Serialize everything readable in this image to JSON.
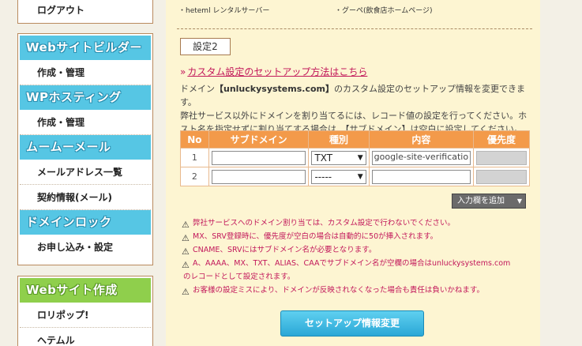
{
  "sidebar": {
    "top_item": "ログアウト",
    "sections": [
      {
        "header": "Webサイトビルダー",
        "items": [
          "作成・管理"
        ]
      },
      {
        "header": "WPホスティング",
        "items": [
          "作成・管理"
        ]
      },
      {
        "header": "ムームーメール",
        "items": [
          "メールアドレス一覧",
          "契約情報(メール)"
        ]
      },
      {
        "header": "ドメインロック",
        "items": [
          "お申し込み・設定"
        ]
      }
    ],
    "bottom_section": {
      "header": "Webサイト作成",
      "items": [
        "ロリポップ!",
        "ヘテムル"
      ]
    }
  },
  "top_links": [
    "・heteml レンタルサーバー",
    "・グーペ(飲食店ホームページ)"
  ],
  "setting_tag": "設定2",
  "help_link": "カスタム設定のセットアップ方法はこちら",
  "description": {
    "p1_pre": "ドメイン",
    "domain": "【unluckysystems.com】",
    "p1_post": "のカスタム設定のセットアップ情報を変更できます。",
    "p2": "弊社サービス以外にドメインを割り当てるには、レコード値の設定を行ってください。ホスト名を指定せずに割り当てする場合は、【サブドメイン】は空白に設定してください。"
  },
  "table": {
    "headers": [
      "No",
      "サブドメイン",
      "種別",
      "内容",
      "優先度"
    ],
    "rows": [
      {
        "no": "1",
        "subdomain": "",
        "type": "TXT",
        "content": "google-site-verificatio",
        "priority": ""
      },
      {
        "no": "2",
        "subdomain": "",
        "type": "-----",
        "content": "",
        "priority": ""
      }
    ]
  },
  "add_row_button": "入力欄を追加",
  "notes": [
    "弊社サービスへのドメイン割り当ては、カスタム設定で行わないでください。",
    "MX、SRV登録時に、優先度が空白の場合は自動的に50が挿入されます。",
    "CNAME、SRVにはサブドメイン名が必要となります。",
    "A、AAAA、MX、TXT、ALIAS、CAAでサブドメイン名が空欄の場合はunluckysystems.com",
    "のレコードとして設定されます。",
    "お客様の設定ミスにより、ドメインが反映されなくなった場合も責任は負いかねます。"
  ],
  "submit_button": "セットアップ情報変更"
}
